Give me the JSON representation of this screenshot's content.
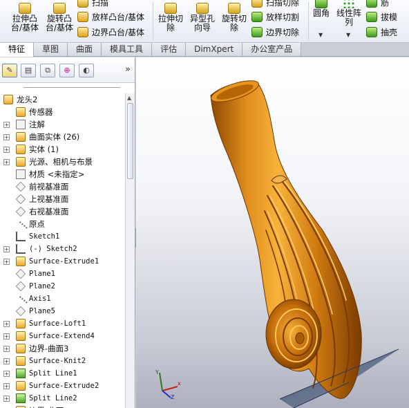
{
  "ribbon": {
    "buttons": [
      {
        "id": "extrude-boss",
        "label1": "拉伸凸",
        "label2": "台/基体"
      },
      {
        "id": "revolve-boss",
        "label1": "旋转凸",
        "label2": "台/基体"
      },
      {
        "id": "extrude-cut",
        "label1": "拉伸切",
        "label2": "除"
      },
      {
        "id": "hole-wizard",
        "label1": "异型孔",
        "label2": "向导"
      },
      {
        "id": "revolve-cut",
        "label1": "旋转切",
        "label2": "除"
      },
      {
        "id": "fillet",
        "label1": "圆角",
        "label2": ""
      },
      {
        "id": "linear-pattern",
        "label1": "线性阵",
        "label2": "列"
      }
    ],
    "small": {
      "sweep": "扫描",
      "loft": "放样凸台/基体",
      "boundary": "边界凸台/基体",
      "sweep_cut": "扫描切除",
      "loft_cut": "放样切割",
      "boundary_cut": "边界切除",
      "rib": "筋",
      "draft": "拔模",
      "shell": "抽壳"
    }
  },
  "tabs": [
    "特征",
    "草图",
    "曲面",
    "模具工具",
    "评估",
    "DimXpert",
    "办公室产品"
  ],
  "panel": {
    "chevron": "»",
    "tree": [
      {
        "level": "root",
        "icon": "part-icon",
        "label": "龙头2",
        "expand": ""
      },
      {
        "level": "child",
        "icon": "sensor-icon",
        "label": "传感器",
        "expand": ""
      },
      {
        "level": "child",
        "icon": "annotation-icon",
        "label": "注解",
        "expand": "+"
      },
      {
        "level": "child",
        "icon": "surface-bodies-icon",
        "label": "曲面实体 (26)",
        "expand": "+"
      },
      {
        "level": "child",
        "icon": "solid-bodies-icon",
        "label": "实体 (1)",
        "expand": "+"
      },
      {
        "level": "child",
        "icon": "lights-icon",
        "label": "光源、相机与布景",
        "expand": "+"
      },
      {
        "level": "child",
        "icon": "material-icon",
        "label": "材质 <未指定>",
        "expand": ""
      },
      {
        "level": "child",
        "icon": "plane-icon",
        "label": "前视基准面",
        "expand": ""
      },
      {
        "level": "child",
        "icon": "plane-icon",
        "label": "上视基准面",
        "expand": ""
      },
      {
        "level": "child",
        "icon": "plane-icon",
        "label": "右视基准面",
        "expand": ""
      },
      {
        "level": "child",
        "icon": "origin-icon",
        "label": "原点",
        "expand": ""
      },
      {
        "level": "child",
        "icon": "sketch-icon",
        "label": "Sketch1",
        "expand": ""
      },
      {
        "level": "child",
        "icon": "sketch-icon",
        "label": "(-) Sketch2",
        "expand": "+"
      },
      {
        "level": "child",
        "icon": "surface-extrude-icon",
        "label": "Surface-Extrude1",
        "expand": "+"
      },
      {
        "level": "child",
        "icon": "plane-icon",
        "label": "Plane1",
        "expand": ""
      },
      {
        "level": "child",
        "icon": "plane-icon",
        "label": "Plane2",
        "expand": ""
      },
      {
        "level": "child",
        "icon": "axis-icon",
        "label": "Axis1",
        "expand": ""
      },
      {
        "level": "child",
        "icon": "plane-icon",
        "label": "Plane5",
        "expand": ""
      },
      {
        "level": "child",
        "icon": "surface-loft-icon",
        "label": "Surface-Loft1",
        "expand": "+"
      },
      {
        "level": "child",
        "icon": "surface-extend-icon",
        "label": "Surface-Extend4",
        "expand": "+"
      },
      {
        "level": "child",
        "icon": "boundary-surface-icon",
        "label": "边界-曲面3",
        "expand": "+"
      },
      {
        "level": "child",
        "icon": "surface-knit-icon",
        "label": "Surface-Knit2",
        "expand": "+"
      },
      {
        "level": "child",
        "icon": "split-line-icon",
        "label": "Split Line1",
        "expand": "+"
      },
      {
        "level": "child",
        "icon": "surface-extrude-icon",
        "label": "Surface-Extrude2",
        "expand": "+"
      },
      {
        "level": "child",
        "icon": "split-line-icon",
        "label": "Split Line2",
        "expand": "+"
      },
      {
        "level": "child",
        "icon": "surface-icon",
        "label": "边界-曲面",
        "expand": "+"
      }
    ]
  },
  "triad": {
    "x": "x",
    "y": "Y",
    "z": "Z"
  },
  "colors": {
    "model": "#e08a18",
    "model_dark": "#8a4a00",
    "ribbon_border": "#b9c3d3"
  }
}
